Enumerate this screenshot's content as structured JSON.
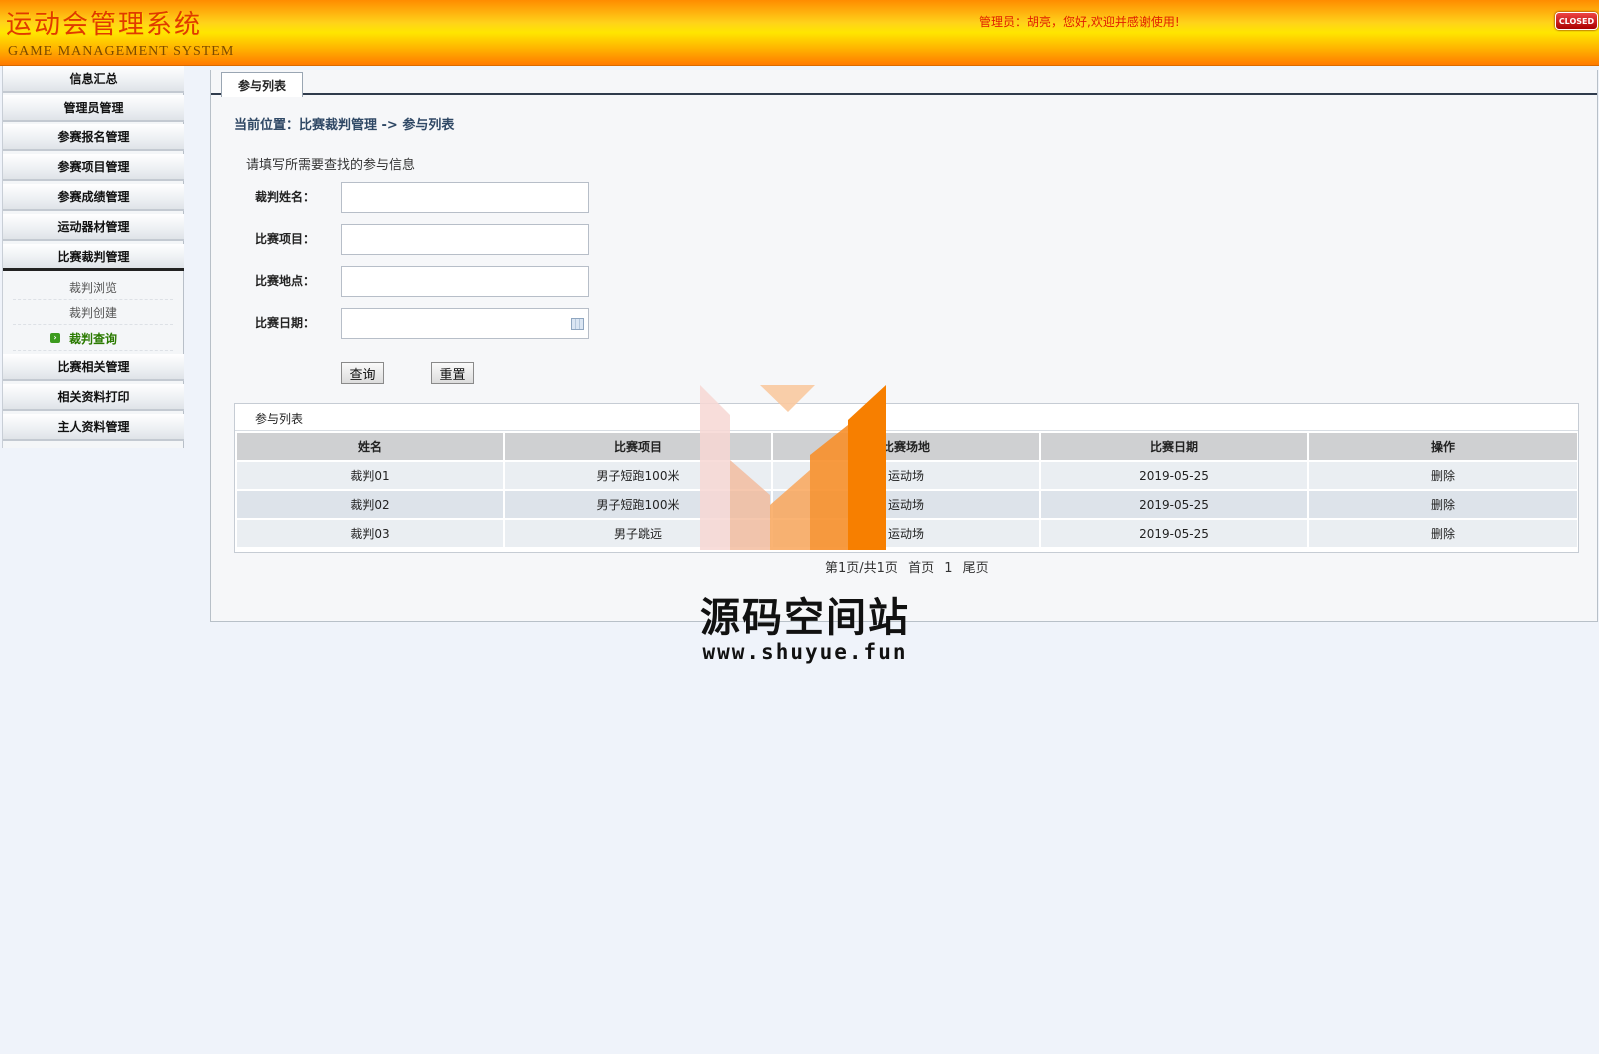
{
  "header": {
    "title": "运动会管理系统",
    "subtitle": "GAME MANAGEMENT SYSTEM",
    "welcome": "管理员：胡亮，您好,欢迎并感谢使用!",
    "close_label": "CLOSED"
  },
  "sidebar": {
    "items": [
      {
        "label": "信息汇总"
      },
      {
        "label": "管理员管理"
      },
      {
        "label": "参赛报名管理"
      },
      {
        "label": "参赛项目管理"
      },
      {
        "label": "参赛成绩管理"
      },
      {
        "label": "运动器材管理"
      },
      {
        "label": "比赛裁判管理"
      },
      {
        "label": "比赛相关管理"
      },
      {
        "label": "相关资料打印"
      },
      {
        "label": "主人资料管理"
      }
    ],
    "sub_items": [
      {
        "label": "裁判浏览"
      },
      {
        "label": "裁判创建"
      },
      {
        "label": "裁判查询"
      }
    ]
  },
  "main": {
    "tab_label": "参与列表",
    "breadcrumb": "当前位置：比赛裁判管理 -> 参与列表",
    "form": {
      "hint": "请填写所需要查找的参与信息",
      "fields": [
        {
          "label": "裁判姓名：",
          "value": ""
        },
        {
          "label": "比赛项目：",
          "value": ""
        },
        {
          "label": "比赛地点：",
          "value": ""
        },
        {
          "label": "比赛日期：",
          "value": ""
        }
      ],
      "search_label": "查询",
      "reset_label": "重置"
    },
    "list": {
      "title": "参与列表",
      "columns": [
        "姓名",
        "比赛项目",
        "比赛场地",
        "比赛日期",
        "操作"
      ],
      "rows": [
        [
          "裁判01",
          "男子短跑100米",
          "运动场",
          "2019-05-25",
          "删除"
        ],
        [
          "裁判02",
          "男子短跑100米",
          "运动场",
          "2019-05-25",
          "删除"
        ],
        [
          "裁判03",
          "男子跳远",
          "运动场",
          "2019-05-25",
          "删除"
        ]
      ]
    },
    "pagination": {
      "info": "第1页/共1页",
      "first": "首页",
      "page": "1",
      "last": "尾页"
    }
  },
  "watermark": {
    "text": "源码空间站",
    "url": "www.shuyue.fun"
  }
}
